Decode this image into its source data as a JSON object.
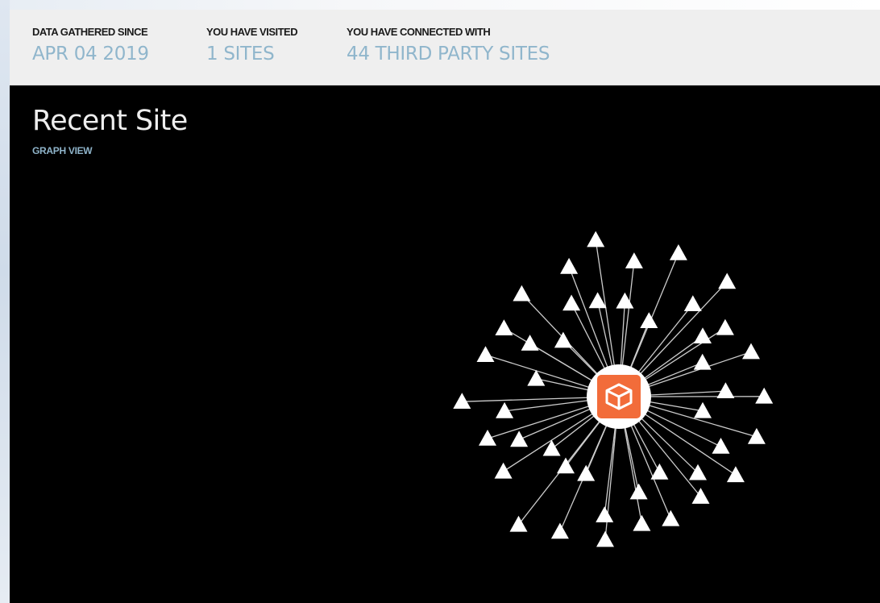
{
  "stats": {
    "since_label": "DATA GATHERED SINCE",
    "since_value": "APR 04 2019",
    "visited_label": "YOU HAVE VISITED",
    "visited_value": "1 SITES",
    "connected_label": "YOU HAVE CONNECTED WITH",
    "connected_value": "44 THIRD PARTY SITES"
  },
  "main": {
    "title": "Recent Site",
    "view_link": "GRAPH VIEW"
  },
  "graph": {
    "center_node": {
      "icon": "box-icon",
      "fill": "#ffffff",
      "accent": "#f26c3a"
    },
    "third_party_count": 44,
    "node_color": "#ffffff",
    "edge_color": "#cccccc"
  },
  "colors": {
    "accent": "#90b6cc",
    "background": "#000000",
    "header_bg": "#efefef"
  }
}
